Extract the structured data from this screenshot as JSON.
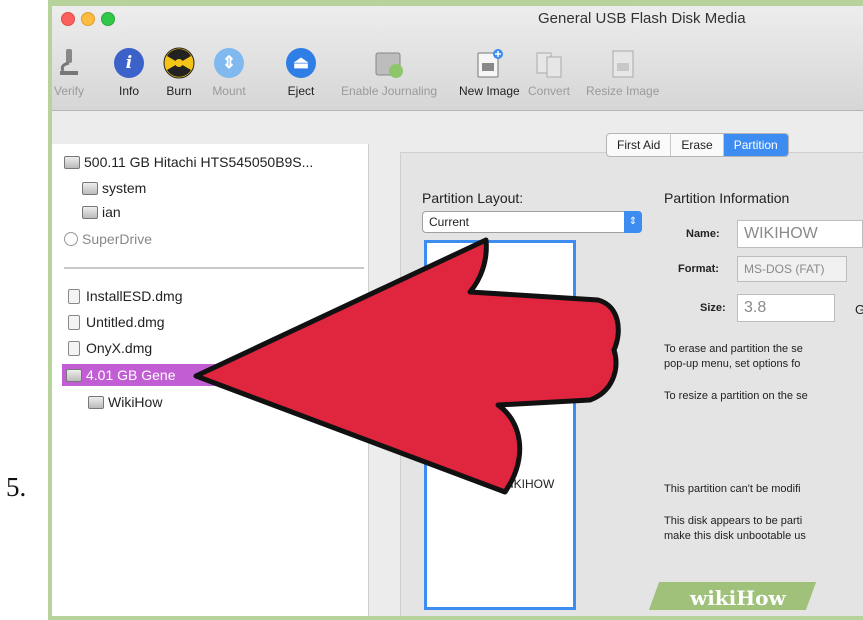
{
  "step_number": "5.",
  "window": {
    "title": "General USB Flash Disk Media"
  },
  "toolbar": [
    {
      "label": "Verify",
      "icon": "microscope-icon",
      "disabled": true
    },
    {
      "label": "Info",
      "icon": "info-icon",
      "disabled": false
    },
    {
      "label": "Burn",
      "icon": "burn-icon",
      "disabled": false
    },
    {
      "label": "Mount",
      "icon": "mount-icon",
      "disabled": true
    },
    {
      "label": "Eject",
      "icon": "eject-icon",
      "disabled": false
    },
    {
      "label": "Enable Journaling",
      "icon": "journaling-icon",
      "disabled": true
    },
    {
      "label": "New Image",
      "icon": "new-image-icon",
      "disabled": false
    },
    {
      "label": "Convert",
      "icon": "convert-icon",
      "disabled": true
    },
    {
      "label": "Resize Image",
      "icon": "resize-image-icon",
      "disabled": true
    }
  ],
  "sidebar": {
    "disk": "500.11 GB Hitachi HTS545050B9S...",
    "volumes": [
      "system",
      "ian"
    ],
    "optical": "SuperDrive",
    "images": [
      "InstallESD.dmg",
      "Untitled.dmg",
      "OnyX.dmg"
    ],
    "selected": "4.01 GB Gene",
    "selected_volume": "WikiHow"
  },
  "tabs": [
    "First Aid",
    "Erase",
    "Partition"
  ],
  "partition": {
    "layout_heading": "Partition Layout:",
    "layout_value": "Current",
    "partition_name": "WIKIHOW",
    "info_heading": "Partition Information",
    "name_label": "Name:",
    "name_value": "WIKIHOW",
    "format_label": "Format:",
    "format_value": "MS-DOS (FAT)",
    "size_label": "Size:",
    "size_value": "3.8",
    "size_unit": "G",
    "text1": "To erase and partition the se",
    "text2": "pop-up menu, set options fo",
    "text3": "To resize a partition on the se",
    "text4": "This partition can't be modifi",
    "text5": "This disk appears to be parti",
    "text6": "make this disk unbootable us"
  },
  "watermark": {
    "wiki": "wiki",
    "how": "How"
  },
  "colors": {
    "accent": "#3c8cf2",
    "selection": "#c15ed3",
    "arrow": "#e0263f"
  }
}
